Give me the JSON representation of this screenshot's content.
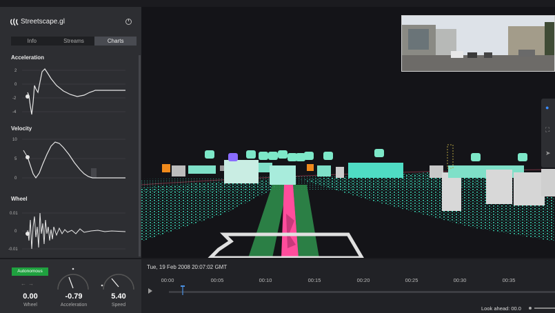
{
  "app": {
    "title": "Streetscape.gl"
  },
  "tabs": [
    {
      "label": "Info",
      "active": false
    },
    {
      "label": "Streams",
      "active": false
    },
    {
      "label": "Charts",
      "active": true
    }
  ],
  "charts": {
    "acceleration": {
      "title": "Acceleration",
      "ticks": [
        "2",
        "0",
        "-2",
        "-4"
      ]
    },
    "velocity": {
      "title": "Velocity",
      "ticks": [
        "10",
        "5",
        "0"
      ]
    },
    "wheel": {
      "title": "Wheel",
      "ticks": [
        "0.01",
        "0",
        "-0.01"
      ]
    }
  },
  "autonomy": {
    "label": "Autonomous"
  },
  "gauges": [
    {
      "value": "0.00",
      "label": "Wheel"
    },
    {
      "value": "-0.79",
      "label": "Acceleration"
    },
    {
      "value": "5.40",
      "label": "Speed"
    }
  ],
  "timeline": {
    "date": "Tue, 19 Feb 2008 20:07:02 GMT",
    "ticks": [
      "00:00",
      "00:05",
      "00:10",
      "00:15",
      "00:20",
      "00:25",
      "00:30",
      "00:35"
    ],
    "progress": 0.035
  },
  "look_ahead": {
    "label": "Look ahead: 00.0"
  },
  "icons": {
    "logo": "streetscape-logo-icon",
    "help": "power-icon",
    "play": "play-icon",
    "map": [
      "car-icon",
      "fit-view-icon",
      "north-arrow-icon"
    ],
    "vehicle_marker": "car-icon"
  },
  "colors": {
    "accent": "#1fa13f",
    "lidar": "#3ff0c8",
    "path": "#ff4d9c",
    "lane": "#2e8b4a",
    "vehicle": "#7de8c8",
    "cyclist": "#8a6cff"
  }
}
